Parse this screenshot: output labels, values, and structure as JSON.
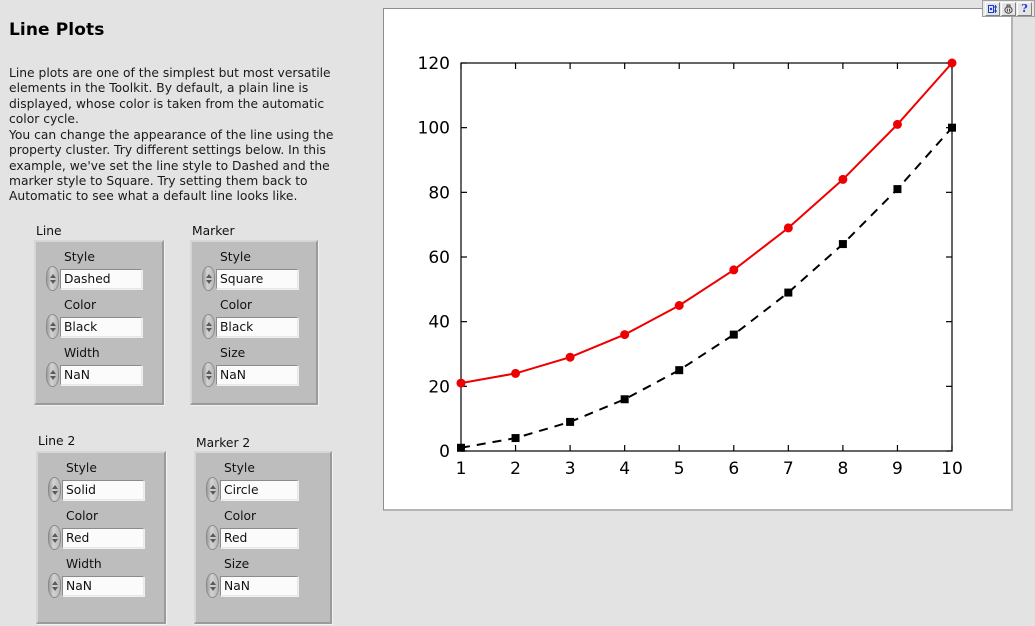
{
  "page": {
    "title": "Line Plots",
    "description_1": "Line plots are one of the simplest but most versatile elements in the Toolkit.  By default, a plain line is displayed, whose color is taken from the automatic color cycle.",
    "description_2": "You can change the appearance of the line using the property cluster.  Try different settings below.  In this example, we've set the line style to Dashed and the marker style to Square.  Try setting them back to Automatic to see what a default line looks like."
  },
  "toolbar": {
    "buttons": [
      {
        "name": "run-button",
        "icon": "run-arrow-icon",
        "label": ""
      },
      {
        "name": "pause-button",
        "icon": "pause-icon",
        "label": ""
      },
      {
        "name": "context-help-button",
        "icon": "question-mark-icon",
        "label": "?"
      }
    ]
  },
  "groups": [
    {
      "name": "line",
      "label": "Line",
      "fields": [
        {
          "name": "line-style",
          "label": "Style",
          "value": "Dashed"
        },
        {
          "name": "line-color",
          "label": "Color",
          "value": "Black"
        },
        {
          "name": "line-width",
          "label": "Width",
          "value": "NaN"
        }
      ]
    },
    {
      "name": "marker",
      "label": "Marker",
      "fields": [
        {
          "name": "marker-style",
          "label": "Style",
          "value": "Square"
        },
        {
          "name": "marker-color",
          "label": "Color",
          "value": "Black"
        },
        {
          "name": "marker-size",
          "label": "Size",
          "value": "NaN"
        }
      ]
    },
    {
      "name": "line-2",
      "label": "Line 2",
      "fields": [
        {
          "name": "line2-style",
          "label": "Style",
          "value": "Solid"
        },
        {
          "name": "line2-color",
          "label": "Color",
          "value": "Red"
        },
        {
          "name": "line2-width",
          "label": "Width",
          "value": "NaN"
        }
      ]
    },
    {
      "name": "marker-2",
      "label": "Marker 2",
      "fields": [
        {
          "name": "marker2-style",
          "label": "Style",
          "value": "Circle"
        },
        {
          "name": "marker2-color",
          "label": "Color",
          "value": "Red"
        },
        {
          "name": "marker2-size",
          "label": "Size",
          "value": "NaN"
        }
      ]
    }
  ],
  "chart_data": {
    "type": "line",
    "title": "",
    "xlabel": "",
    "ylabel": "",
    "x": [
      1,
      2,
      3,
      4,
      5,
      6,
      7,
      8,
      9,
      10
    ],
    "xlim": [
      1,
      10
    ],
    "ylim": [
      0,
      120
    ],
    "xticks": [
      1,
      2,
      3,
      4,
      5,
      6,
      7,
      8,
      9,
      10
    ],
    "yticks": [
      0,
      20,
      40,
      60,
      80,
      100,
      120
    ],
    "xticklabels": [
      "1",
      "2",
      "3",
      "4",
      "5",
      "6",
      "7",
      "8",
      "9",
      "10"
    ],
    "yticklabels": [
      "0",
      "20",
      "40",
      "60",
      "80",
      "100",
      "120"
    ],
    "grid": false,
    "legend": "none",
    "series": [
      {
        "name": "Line",
        "values": [
          1,
          4,
          9,
          16,
          25,
          36,
          49,
          64,
          81,
          100
        ],
        "line_style": "dashed",
        "line_color": "#000000",
        "marker_style": "square",
        "marker_color": "#000000",
        "marker_size": 7
      },
      {
        "name": "Line 2",
        "values": [
          21,
          24,
          29,
          36,
          45,
          56,
          69,
          84,
          101,
          120
        ],
        "line_style": "solid",
        "line_color": "#ee0000",
        "marker_style": "circle",
        "marker_color": "#ee0000",
        "marker_size": 8
      }
    ]
  },
  "colors": {
    "page_background": "#e3e3e3",
    "panel_background": "#ffffff",
    "group_background": "#bdbdbd",
    "accent_red": "#ee0000",
    "accent_black": "#000000"
  }
}
